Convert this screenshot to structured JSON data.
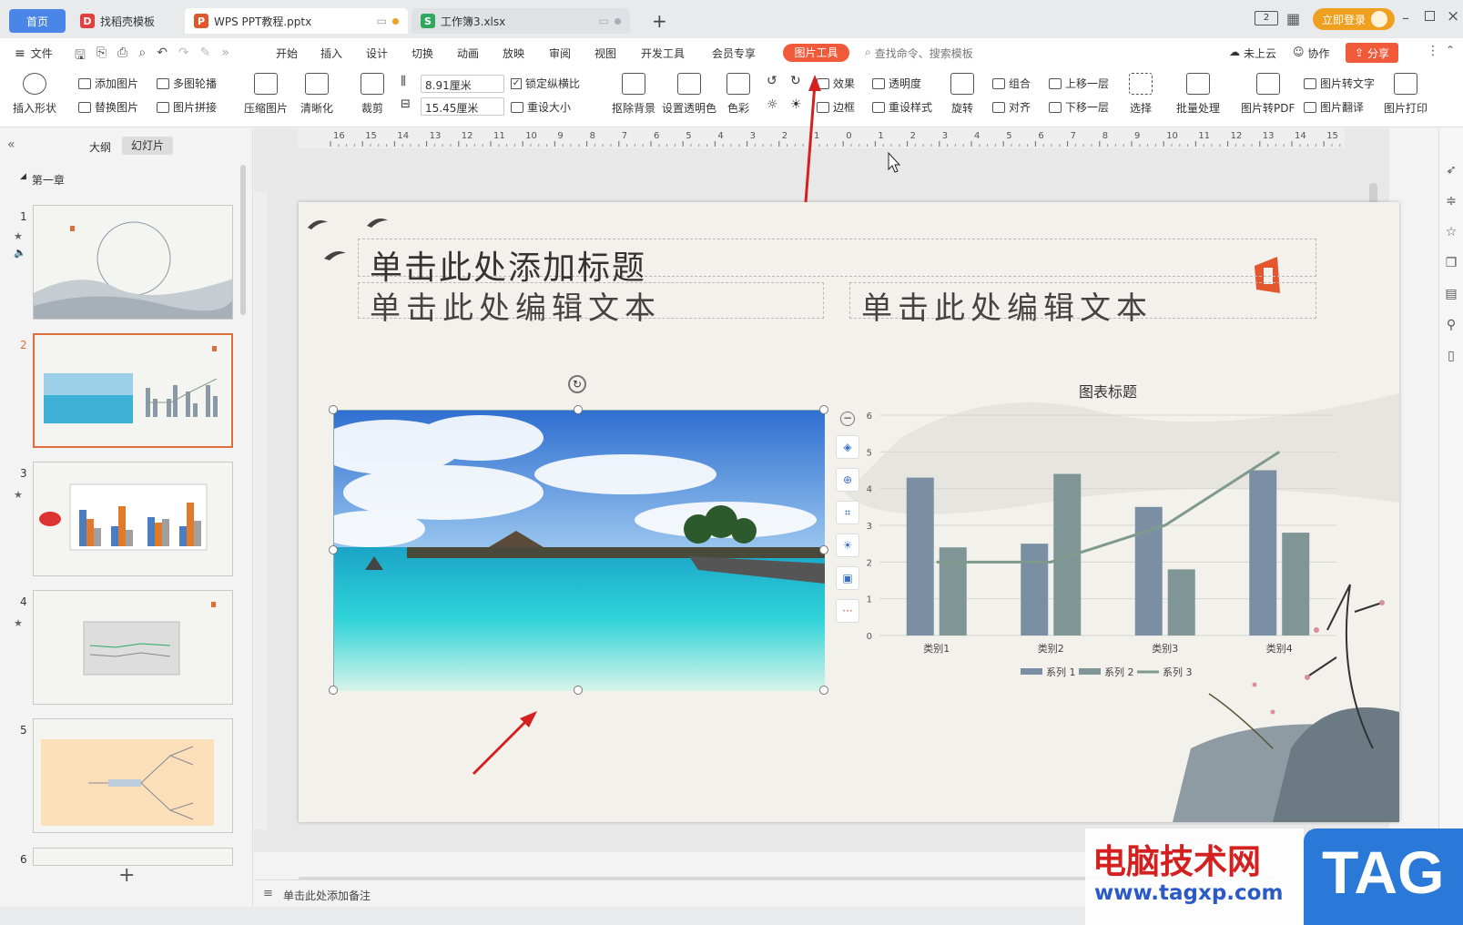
{
  "tabs": {
    "home": "首页",
    "doc1": "找稻壳模板",
    "doc2": "WPS PPT教程.pptx",
    "doc3": "工作簿3.xlsx"
  },
  "titlebar": {
    "badge": "2",
    "login": "立即登录"
  },
  "menu": {
    "file": "文件",
    "items": [
      "开始",
      "插入",
      "设计",
      "切换",
      "动画",
      "放映",
      "审阅",
      "视图",
      "开发工具",
      "会员专享"
    ],
    "active": "图片工具",
    "search": "查找命令、搜索模板",
    "cloud": "未上云",
    "collab": "协作",
    "share": "分享"
  },
  "ribbon": {
    "insert_shape": "插入形状",
    "add_image": "添加图片",
    "replace_image": "替换图片",
    "multi_carousel": "多图轮播",
    "image_collage": "图片拼接",
    "compress": "压缩图片",
    "clarify": "清晰化",
    "crop": "裁剪",
    "width": "8.91厘米",
    "height": "15.45厘米",
    "lock_ratio": "锁定纵横比",
    "reset_size": "重设大小",
    "remove_bg": "抠除背景",
    "set_transparent": "设置透明色",
    "color": "色彩",
    "effect": "效果",
    "border": "边框",
    "transparency": "透明度",
    "reset_style": "重设样式",
    "rotate": "旋转",
    "group": "组合",
    "align": "对齐",
    "bring_forward": "上移一层",
    "send_backward": "下移一层",
    "select": "选择",
    "batch": "批量处理",
    "to_pdf": "图片转PDF",
    "to_text": "图片转文字",
    "translate": "图片翻译",
    "print": "图片打印"
  },
  "leftpanel": {
    "tab_outline": "大纲",
    "tab_slides": "幻灯片",
    "section": "第一章",
    "slide_numbers": [
      "1",
      "2",
      "3",
      "4",
      "5",
      "6"
    ],
    "add": "+"
  },
  "ruler": {
    "h_labels": [
      "16",
      "15",
      "14",
      "13",
      "12",
      "11",
      "10",
      "9",
      "8",
      "7",
      "6",
      "5",
      "4",
      "3",
      "2",
      "1",
      "0",
      "1",
      "2",
      "3",
      "4",
      "5",
      "6",
      "7",
      "8",
      "9",
      "10",
      "11",
      "12",
      "13",
      "14",
      "15",
      "16"
    ]
  },
  "slide": {
    "title_placeholder": "单击此处添加标题",
    "text_left": "单击此处编辑文本",
    "text_right": "单击此处编辑文本"
  },
  "chart_data": {
    "type": "bar",
    "title": "图表标题",
    "categories": [
      "类别1",
      "类别2",
      "类别3",
      "类别4"
    ],
    "ylim": [
      0,
      6
    ],
    "yticks": [
      "0",
      "1",
      "2",
      "3",
      "4",
      "5",
      "6"
    ],
    "series": [
      {
        "name": "系列 1",
        "values": [
          4.3,
          2.5,
          3.5,
          4.5
        ],
        "kind": "bar",
        "color": "#7a8fa3"
      },
      {
        "name": "系列 2",
        "values": [
          2.4,
          4.4,
          1.8,
          2.8
        ],
        "kind": "bar",
        "color": "#7f9596"
      },
      {
        "name": "系列 3",
        "values": [
          2,
          2,
          3,
          5
        ],
        "kind": "line",
        "color": "#7f9a8c"
      }
    ],
    "legend": "bottom"
  },
  "notes": {
    "placeholder": "单击此处添加备注"
  },
  "watermark": {
    "site": "电脑技术网",
    "url": "www.tagxp.com",
    "tag": "TAG"
  }
}
